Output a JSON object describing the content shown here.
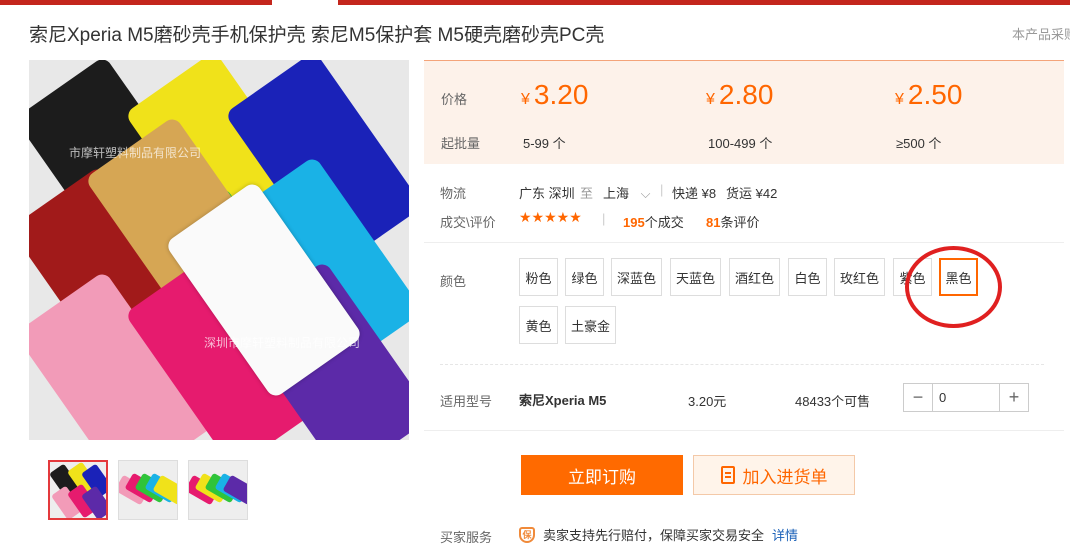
{
  "title": "索尼Xperia M5磨砂壳手机保护壳 索尼M5保护套 M5硬壳磨砂壳PC壳",
  "corner_link": "本产品采购",
  "image": {
    "watermark": "市摩轩塑料制品有限公司",
    "watermark2": "深圳市摩轩塑料制品有限公司"
  },
  "price": {
    "price_label": "价格",
    "moq_label": "起批量",
    "currency": "¥",
    "tiers": [
      {
        "price": "3.20",
        "qty": "5-99 个"
      },
      {
        "price": "2.80",
        "qty": "100-499 个"
      },
      {
        "price": "2.50",
        "qty": "≥500 个"
      }
    ]
  },
  "logistics": {
    "label": "物流",
    "from": "广东 深圳",
    "to_word": "至",
    "to": "上海",
    "express": "快递 ¥8",
    "freight": "货运 ¥42"
  },
  "deals": {
    "label": "成交\\评价",
    "stars": "★★★★★",
    "count_num": "195",
    "count_text": "个成交",
    "review_num": "81",
    "review_text": "条评价"
  },
  "color": {
    "label": "颜色",
    "options": [
      "粉色",
      "绿色",
      "深蓝色",
      "天蓝色",
      "酒红色",
      "白色",
      "玫红色",
      "紫色",
      "黑色",
      "黄色",
      "土豪金"
    ],
    "selected": "黑色"
  },
  "model": {
    "label": "适用型号",
    "name": "索尼Xperia M5",
    "unit_price": "3.20元",
    "stock": "48433个可售",
    "quantity": "0"
  },
  "actions": {
    "buy": "立即订购",
    "cart": "加入进货单"
  },
  "service": {
    "label": "买家服务",
    "badge": "保",
    "text": "卖家支持先行赔付，保障买家交易安全",
    "link": "详情"
  },
  "colors": {
    "accent": "#ff6600",
    "buy": "#ff6a00",
    "top_bar": "#c4261d",
    "annotation": "#e02020"
  }
}
